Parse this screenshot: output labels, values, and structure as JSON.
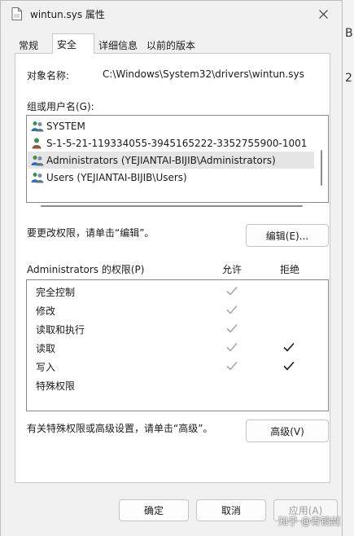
{
  "window": {
    "title": "wintun.sys 属性",
    "close_icon": "close-icon",
    "file_icon": "document-icon"
  },
  "background": {
    "glyph_top": "B",
    "glyph_mid": "2"
  },
  "tabs": [
    {
      "label": "常规",
      "active": false
    },
    {
      "label": "安全",
      "active": true
    },
    {
      "label": "详细信息",
      "active": false
    },
    {
      "label": "以前的版本",
      "active": false
    }
  ],
  "security": {
    "object_name_label": "对象名称:",
    "object_name_value": "C:\\Windows\\System32\\drivers\\wintun.sys",
    "groups_label": "组或用户名(G):",
    "users": [
      {
        "name": "SYSTEM",
        "icon": "user-group-icon",
        "selected": false
      },
      {
        "name": "S-1-5-21-119334055-3945165222-3352755900-1001",
        "icon": "user-icon",
        "selected": false
      },
      {
        "name": "Administrators (YEJIANTAI-BIJIB\\Administrators)",
        "icon": "user-group-icon",
        "selected": true
      },
      {
        "name": "Users (YEJIANTAI-BIJIB\\Users)",
        "icon": "user-group-icon",
        "selected": false
      }
    ],
    "edit_hint": "要更改权限，请单击“编辑”。",
    "edit_button": "编辑(E)...",
    "permissions_label": "Administrators 的权限(P)",
    "allow_header": "允许",
    "deny_header": "拒绝",
    "permissions": [
      {
        "name": "完全控制",
        "allow": "inherited",
        "deny": "none"
      },
      {
        "name": "修改",
        "allow": "inherited",
        "deny": "none"
      },
      {
        "name": "读取和执行",
        "allow": "inherited",
        "deny": "none"
      },
      {
        "name": "读取",
        "allow": "inherited",
        "deny": "explicit"
      },
      {
        "name": "写入",
        "allow": "inherited",
        "deny": "explicit"
      },
      {
        "name": "特殊权限",
        "allow": "none",
        "deny": "none"
      }
    ],
    "advanced_hint": "有关特殊权限或高级设置，请单击“高级”。",
    "advanced_button": "高级(V)"
  },
  "footer": {
    "ok_button": "确定",
    "cancel_button": "取消",
    "apply_button": "应用(A)",
    "apply_enabled": false
  },
  "watermark": "知乎 @青铜剑",
  "colors": {
    "inherited_check": "#a8a8a8",
    "explicit_check": "#1a1a1a",
    "selected_row": "#e5e5e5"
  }
}
